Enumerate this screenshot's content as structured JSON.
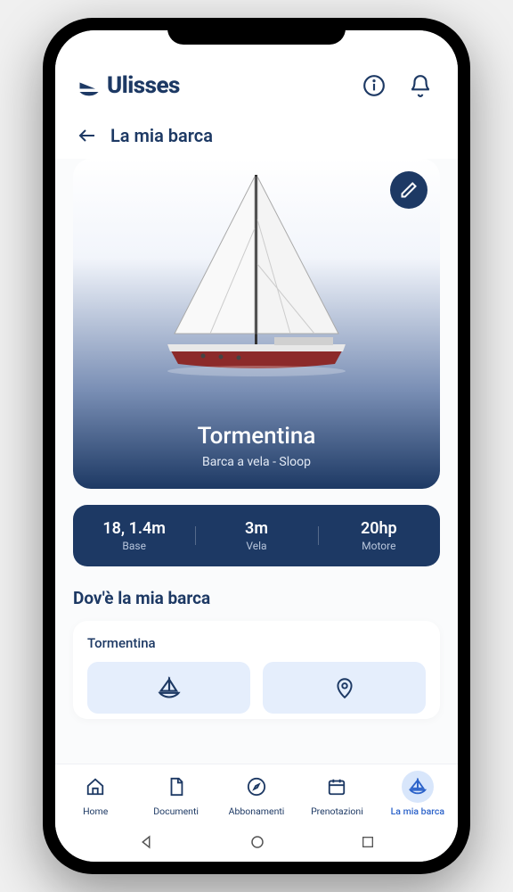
{
  "app": {
    "name": "Ulisses"
  },
  "page": {
    "title": "La mia barca"
  },
  "boat": {
    "name": "Tormentina",
    "type": "Barca a vela - Sloop",
    "stats": [
      {
        "value": "18, 1.4m",
        "label": "Base"
      },
      {
        "value": "3m",
        "label": "Vela"
      },
      {
        "value": "20hp",
        "label": "Motore"
      }
    ]
  },
  "location": {
    "section_title": "Dov'è la mia barca",
    "boat_name": "Tormentina"
  },
  "nav": {
    "items": [
      {
        "label": "Home"
      },
      {
        "label": "Documenti"
      },
      {
        "label": "Abbonamenti"
      },
      {
        "label": "Prenotazioni"
      },
      {
        "label": "La mia barca"
      }
    ]
  }
}
